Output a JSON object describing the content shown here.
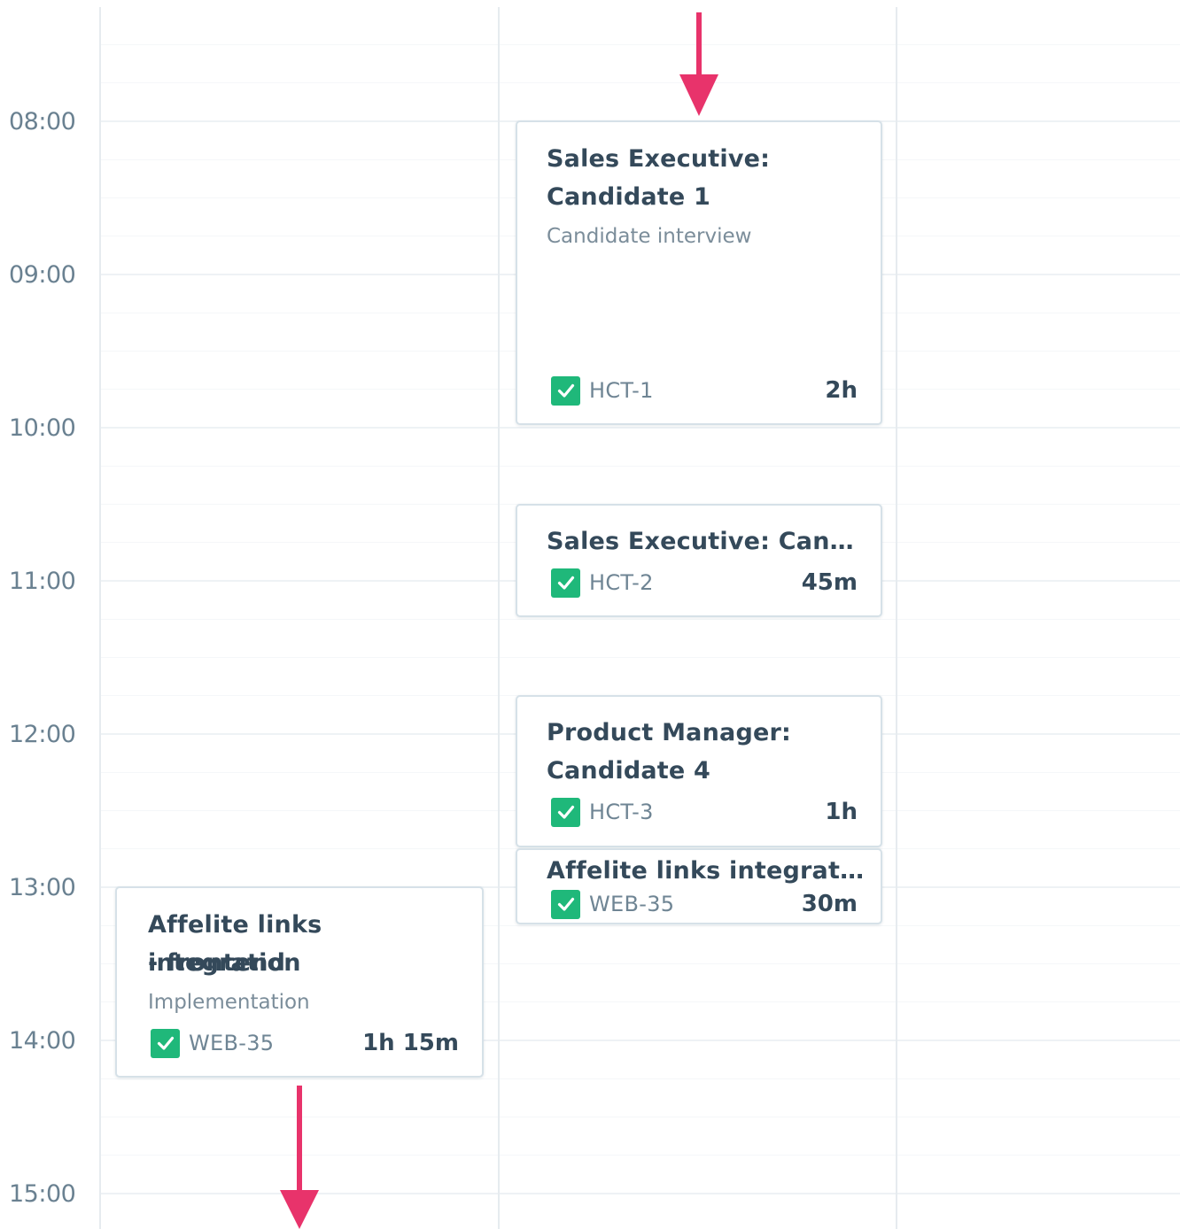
{
  "time_labels": [
    "08:00",
    "09:00",
    "10:00",
    "11:00",
    "12:00",
    "13:00",
    "14:00",
    "15:00"
  ],
  "events": [
    {
      "title_line1": "Sales Executive:",
      "title_line2": "Candidate 1",
      "subtitle": "Candidate interview",
      "task_key": "HCT-1",
      "duration": "2h"
    },
    {
      "title": "Sales Executive: Candid...",
      "task_key": "HCT-2",
      "duration": "45m"
    },
    {
      "title_line1": "Product Manager:",
      "title_line2": "Candidate 4",
      "task_key": "HCT-3",
      "duration": "1h"
    },
    {
      "title": "Affelite links integratio...",
      "task_key": "WEB-35",
      "duration": "30m"
    },
    {
      "title_line1": "Affelite links integration",
      "title_line2": "- frontend",
      "subtitle": "Implementation",
      "task_key": "WEB-35",
      "duration": "1h 15m"
    }
  ],
  "colors": {
    "accent_check": "#1fb87a",
    "arrow": "#e8336b",
    "card_border": "#d6e1e8",
    "text_dark": "#34495a",
    "text_muted": "#6f8594"
  },
  "icons": {
    "status": "checkbox-checked-icon",
    "drag_indicator": "arrow-down-icon"
  }
}
